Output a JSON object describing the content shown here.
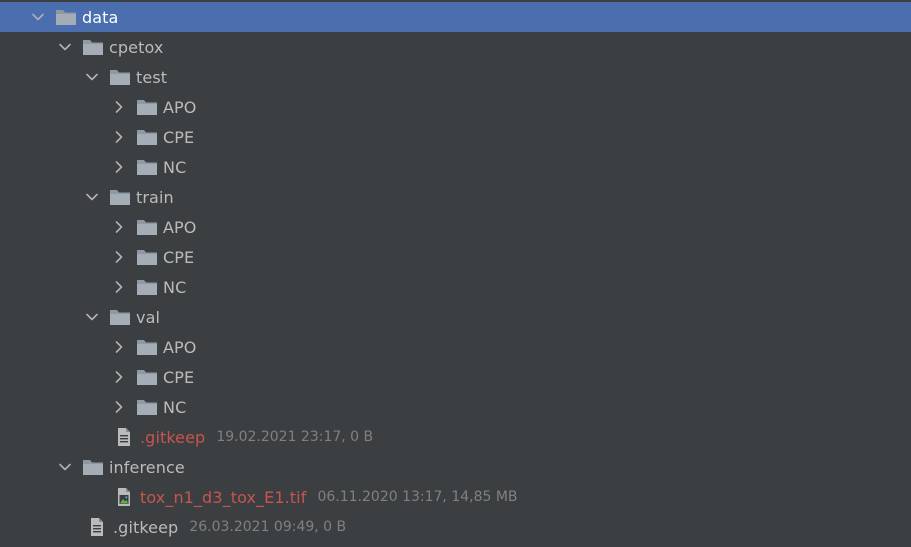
{
  "tree": {
    "data": {
      "label": "data"
    },
    "cpetox": {
      "label": "cpetox"
    },
    "test": {
      "label": "test"
    },
    "test_apo": {
      "label": "APO"
    },
    "test_cpe": {
      "label": "CPE"
    },
    "test_nc": {
      "label": "NC"
    },
    "train": {
      "label": "train"
    },
    "train_apo": {
      "label": "APO"
    },
    "train_cpe": {
      "label": "CPE"
    },
    "train_nc": {
      "label": "NC"
    },
    "val": {
      "label": "val"
    },
    "val_apo": {
      "label": "APO"
    },
    "val_cpe": {
      "label": "CPE"
    },
    "val_nc": {
      "label": "NC"
    },
    "cpetox_gitkeep": {
      "label": ".gitkeep",
      "meta": "19.02.2021 23:17, 0 B"
    },
    "inference": {
      "label": "inference"
    },
    "tif_file": {
      "label": "tox_n1_d3_tox_E1.tif",
      "meta": "06.11.2020 13:17, 14,85 MB"
    },
    "data_gitkeep": {
      "label": ".gitkeep",
      "meta": "26.03.2021 09:49, 0 B"
    }
  },
  "icons": {
    "folder": "folder-icon",
    "chevron_expanded": "chevron-down-icon",
    "chevron_collapsed": "chevron-right-icon",
    "text_file": "text-file-icon",
    "image_file": "image-file-icon"
  },
  "colors": {
    "background": "#3c3f41",
    "selection": "#4b6eaf",
    "text": "#bbbbbb",
    "modified_file": "#c7554b",
    "meta_text": "#808080",
    "folder": "#8f99a3"
  }
}
